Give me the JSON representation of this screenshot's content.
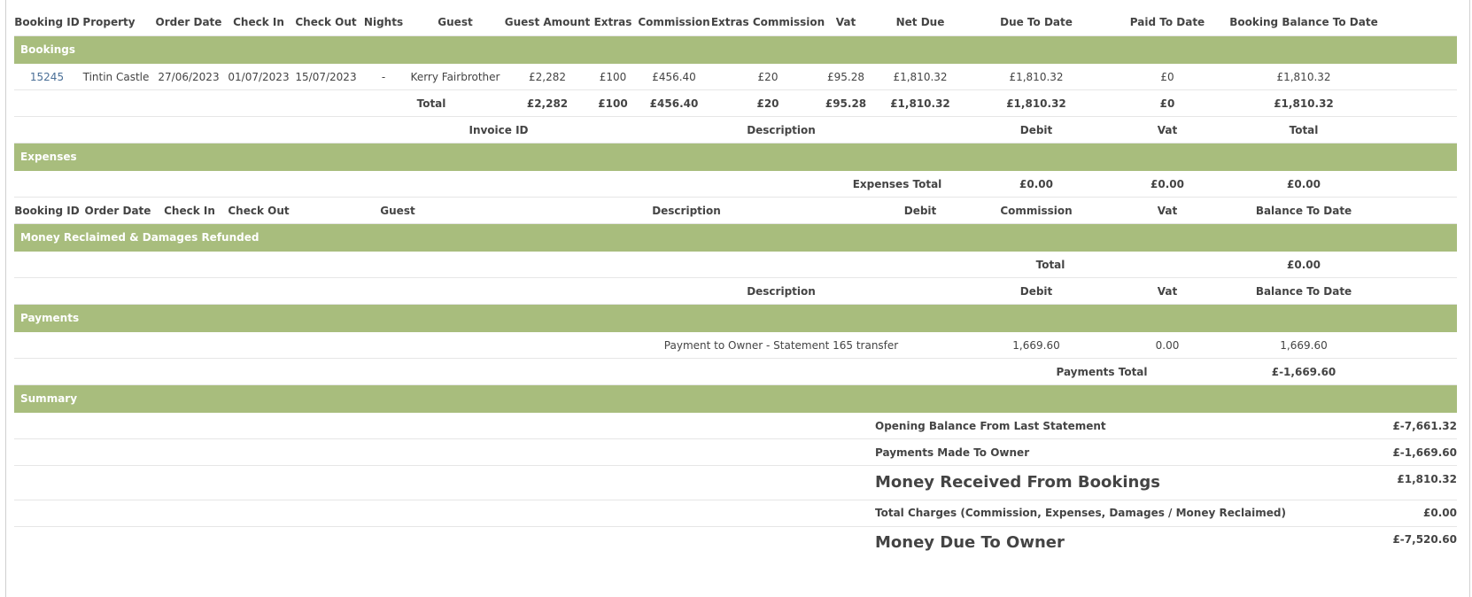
{
  "bookings_header": {
    "cols": [
      "Booking ID",
      "Property",
      "Order Date",
      "Check In",
      "Check Out",
      "Nights",
      "Guest",
      "Guest Amount",
      "Extras",
      "Commission",
      "Extras Commission",
      "Vat",
      "Net Due",
      "Due To Date",
      "Paid To Date",
      "Booking Balance To Date"
    ]
  },
  "bookings": {
    "title": "Bookings",
    "row": {
      "booking_id": "15245",
      "property": "Tintin Castle",
      "order_date": "27/06/2023",
      "check_in": "01/07/2023",
      "check_out": "15/07/2023",
      "nights": "-",
      "guest": "Kerry Fairbrother",
      "guest_amount": "£2,282",
      "extras": "£100",
      "commission": "£456.40",
      "extras_commission": "£20",
      "vat": "£95.28",
      "net_due": "£1,810.32",
      "due_to_date": "£1,810.32",
      "paid_to_date": "£0",
      "balance_to_date": "£1,810.32"
    },
    "total": {
      "label": "Total",
      "guest_amount": "£2,282",
      "extras": "£100",
      "commission": "£456.40",
      "extras_commission": "£20",
      "vat": "£95.28",
      "net_due": "£1,810.32",
      "due_to_date": "£1,810.32",
      "paid_to_date": "£0",
      "balance_to_date": "£1,810.32"
    }
  },
  "expenses_header": {
    "invoice_id": "Invoice ID",
    "description": "Description",
    "debit": "Debit",
    "vat": "Vat",
    "total": "Total"
  },
  "expenses": {
    "title": "Expenses",
    "total_label": "Expenses Total",
    "debit": "£0.00",
    "vat": "£0.00",
    "total": "£0.00"
  },
  "reclaim_header": {
    "booking_id": "Booking ID",
    "order_date": "Order Date",
    "check_in": "Check In",
    "check_out": "Check Out",
    "guest": "Guest",
    "description": "Description",
    "debit": "Debit",
    "commission": "Commission",
    "vat": "Vat",
    "balance": "Balance To Date"
  },
  "reclaim": {
    "title": "Money Reclaimed & Damages Refunded",
    "total_label": "Total",
    "total": "£0.00"
  },
  "payments_header": {
    "description": "Description",
    "debit": "Debit",
    "vat": "Vat",
    "balance": "Balance To Date"
  },
  "payments": {
    "title": "Payments",
    "row": {
      "description": "Payment to Owner - Statement 165 transfer",
      "debit": "1,669.60",
      "vat": "0.00",
      "balance": "1,669.60"
    },
    "total_label": "Payments Total",
    "total": "£-1,669.60"
  },
  "summary": {
    "title": "Summary",
    "opening_label": "Opening Balance From Last Statement",
    "opening_value": "£-7,661.32",
    "payments_label": "Payments Made To Owner",
    "payments_value": "£-1,669.60",
    "received_label": "Money Received From Bookings",
    "received_value": "£1,810.32",
    "charges_label": "Total Charges (Commission, Expenses, Damages / Money Reclaimed)",
    "charges_value": "£0.00",
    "due_label": "Money Due To Owner",
    "due_value": "£-7,520.60"
  },
  "colors": {
    "band": "#a8bd7d",
    "link": "#4a6f97",
    "text": "#444444"
  }
}
